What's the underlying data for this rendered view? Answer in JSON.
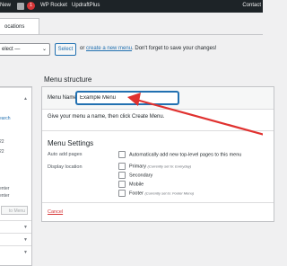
{
  "adminbar": {
    "new": "New",
    "badge": "1",
    "wp_rocket": "WP Rocket",
    "updraft": "UpdraftPlus",
    "contact": "Contact"
  },
  "tabs": {
    "locations": "ocations"
  },
  "select_row": {
    "select_value": "elect —",
    "select_button": "Select",
    "or": "or",
    "create_link": "create a new menu",
    "reminder": ". Don't forget to save your changes!"
  },
  "left": {
    "search": "earch",
    "items": [
      "22",
      "22",
      "enter",
      "enter"
    ],
    "add_button": "to Menu"
  },
  "menu_structure": {
    "heading": "Menu structure",
    "name_label": "Menu Name",
    "name_value": "Example Menu",
    "instructions": "Give your menu a name, then click Create Menu."
  },
  "settings": {
    "heading": "Menu Settings",
    "auto_add_label": "Auto add pages",
    "auto_add_option": "Automatically add new top-level pages to this menu",
    "display_label": "Display location",
    "locations": [
      {
        "name": "Primary",
        "note": "(Currently set to: Everyday)"
      },
      {
        "name": "Secondary",
        "note": ""
      },
      {
        "name": "Mobile",
        "note": ""
      },
      {
        "name": "Footer",
        "note": "(Currently set to: Footer Menu)"
      }
    ]
  },
  "cancel": "Cancel",
  "colors": {
    "accent": "#2271b1",
    "arrow": "#e0312f",
    "adminbar": "#1d2327"
  }
}
